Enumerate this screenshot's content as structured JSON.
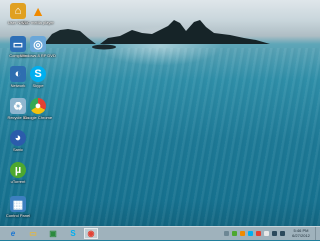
{
  "desktop": {
    "icons": [
      {
        "name": "User Name",
        "icon": "user-folder-icon",
        "color": "#e0a020"
      },
      {
        "name": "VLC media player",
        "icon": "vlc-icon",
        "color": "#f08a00"
      },
      {
        "name": "Computer",
        "icon": "computer-icon",
        "color": "#2d6fb6"
      },
      {
        "name": "Windows 8 RP DVD",
        "icon": "dvd-drive-icon",
        "color": "#6aa7d8"
      },
      {
        "name": "Network",
        "icon": "network-icon",
        "color": "#2e6eb0"
      },
      {
        "name": "Skype",
        "icon": "skype-icon",
        "color": "#00aff0"
      },
      {
        "name": "Recycle Bin",
        "icon": "recycle-bin-icon",
        "color": "#8fb6cf"
      },
      {
        "name": "Google Chrome",
        "icon": "chrome-icon",
        "color": "#e34133"
      },
      {
        "name": "Sanic",
        "icon": "sanic-icon",
        "color": "#2b5cab"
      },
      {
        "name": "uTorrent",
        "icon": "utorrent-icon",
        "color": "#4da82f"
      },
      {
        "name": "Control Panel",
        "icon": "control-panel-icon",
        "color": "#3c7fbf"
      }
    ]
  },
  "taskbar": {
    "items": [
      {
        "name": "Internet Explorer",
        "icon": "ie-icon",
        "glyph": "e",
        "color": "#1e78d2",
        "active": false
      },
      {
        "name": "File Explorer",
        "icon": "folder-icon",
        "glyph": "▭",
        "color": "#e3b742",
        "active": false
      },
      {
        "name": "Windows Store",
        "icon": "store-icon",
        "glyph": "▣",
        "color": "#2c8a3e",
        "active": false
      },
      {
        "name": "Skype",
        "icon": "skype-icon",
        "glyph": "S",
        "color": "#00aff0",
        "active": false
      },
      {
        "name": "Google Chrome",
        "icon": "chrome-icon",
        "glyph": "◉",
        "color": "#e34133",
        "active": true
      }
    ],
    "clock": {
      "time": "5:46 PM",
      "date": "6/27/2012"
    }
  }
}
